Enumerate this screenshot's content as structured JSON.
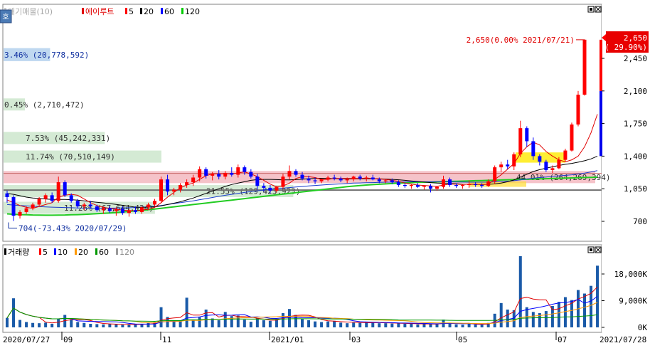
{
  "chart_data": [
    {
      "type": "candlestick",
      "title": "",
      "legend": [
        {
          "label": "대기매물(10)",
          "color": "#c8c8c8"
        },
        {
          "label": "에이루트",
          "color": "#e00000"
        },
        {
          "label": "5",
          "color": "#ff0000"
        },
        {
          "label": "20",
          "color": "#000000"
        },
        {
          "label": "60",
          "color": "#0000ff"
        },
        {
          "label": "120",
          "color": "#00cc00"
        }
      ],
      "y_ticks": [
        "2,450",
        "2,100",
        "1,750",
        "1,400",
        "1,050",
        "700"
      ],
      "y_tick_values": [
        2450,
        2100,
        1750,
        1400,
        1050,
        700
      ],
      "ylim": [
        520,
        2800
      ],
      "x_ticks": [
        "2020/07/27",
        "09",
        "11",
        "2021/01",
        "03",
        "05",
        "07",
        "2021/07/28"
      ],
      "price_label": {
        "value": "2,650",
        "change": "( 29.90%)"
      },
      "high_annotation": "2,650(0.00% 2021/07/21)",
      "low_annotation": "704(-73.43% 2020/07/29)",
      "volume_profile": [
        {
          "text": "3.46% (20,778,592)",
          "price_low": 2420,
          "price_high": 2560,
          "pct": 3.46
        },
        {
          "text": "0.45% (2,710,472)",
          "price_low": 1890,
          "price_high": 2020,
          "pct": 0.45
        },
        {
          "text": "7.53% (45,242,331)",
          "price_low": 1530,
          "price_high": 1660,
          "pct": 7.53
        },
        {
          "text": "11.74% (70,510,149)",
          "price_low": 1330,
          "price_high": 1460,
          "pct": 11.74
        },
        {
          "text": "21.55% (129,423,923)",
          "price_low": 960,
          "price_high": 1090,
          "pct": 21.55
        },
        {
          "text": "11.26% (67,644,434)",
          "price_low": 780,
          "price_high": 910,
          "pct": 11.26
        },
        {
          "text": "44.01% (264,269,394)",
          "price_low": 1110,
          "price_high": 1240,
          "pct": 44.01
        }
      ],
      "ohlc": [
        [
          1000,
          1030,
          900,
          960
        ],
        [
          960,
          980,
          704,
          760
        ],
        [
          760,
          820,
          730,
          800
        ],
        [
          800,
          860,
          780,
          840
        ],
        [
          840,
          900,
          820,
          880
        ],
        [
          880,
          960,
          860,
          940
        ],
        [
          940,
          1000,
          900,
          980
        ],
        [
          980,
          1010,
          900,
          920
        ],
        [
          920,
          1180,
          900,
          1120
        ],
        [
          1120,
          1140,
          960,
          980
        ],
        [
          980,
          1000,
          900,
          920
        ],
        [
          920,
          940,
          840,
          860
        ],
        [
          860,
          900,
          820,
          880
        ],
        [
          880,
          920,
          840,
          860
        ],
        [
          860,
          880,
          800,
          820
        ],
        [
          820,
          860,
          780,
          840
        ],
        [
          840,
          870,
          790,
          810
        ],
        [
          810,
          850,
          760,
          830
        ],
        [
          830,
          860,
          770,
          790
        ],
        [
          790,
          830,
          750,
          820
        ],
        [
          820,
          860,
          780,
          800
        ],
        [
          800,
          860,
          780,
          850
        ],
        [
          850,
          900,
          820,
          880
        ],
        [
          880,
          940,
          860,
          920
        ],
        [
          920,
          1180,
          900,
          1150
        ],
        [
          1150,
          1200,
          980,
          1020
        ],
        [
          1020,
          1060,
          980,
          1040
        ],
        [
          1040,
          1110,
          1010,
          1090
        ],
        [
          1090,
          1150,
          1060,
          1120
        ],
        [
          1120,
          1200,
          1080,
          1170
        ],
        [
          1170,
          1290,
          1130,
          1260
        ],
        [
          1260,
          1280,
          1160,
          1190
        ],
        [
          1190,
          1230,
          1140,
          1210
        ],
        [
          1210,
          1250,
          1150,
          1180
        ],
        [
          1180,
          1240,
          1150,
          1220
        ],
        [
          1220,
          1280,
          1180,
          1200
        ],
        [
          1200,
          1310,
          1170,
          1280
        ],
        [
          1280,
          1300,
          1200,
          1230
        ],
        [
          1230,
          1260,
          1160,
          1180
        ],
        [
          1180,
          1210,
          1040,
          1080
        ],
        [
          1080,
          1110,
          1020,
          1060
        ],
        [
          1060,
          1090,
          1000,
          1030
        ],
        [
          1030,
          1080,
          1010,
          1070
        ],
        [
          1070,
          1210,
          1050,
          1180
        ],
        [
          1180,
          1300,
          1150,
          1240
        ],
        [
          1240,
          1260,
          1180,
          1200
        ],
        [
          1200,
          1230,
          1140,
          1160
        ],
        [
          1160,
          1190,
          1110,
          1140
        ],
        [
          1140,
          1170,
          1100,
          1130
        ],
        [
          1130,
          1160,
          1110,
          1150
        ],
        [
          1150,
          1190,
          1130,
          1170
        ],
        [
          1170,
          1200,
          1140,
          1160
        ],
        [
          1160,
          1180,
          1120,
          1140
        ],
        [
          1140,
          1170,
          1110,
          1150
        ],
        [
          1150,
          1190,
          1130,
          1180
        ],
        [
          1180,
          1200,
          1140,
          1160
        ],
        [
          1160,
          1190,
          1130,
          1170
        ],
        [
          1170,
          1200,
          1140,
          1150
        ],
        [
          1150,
          1170,
          1110,
          1130
        ],
        [
          1130,
          1150,
          1110,
          1140
        ],
        [
          1140,
          1160,
          1100,
          1120
        ],
        [
          1120,
          1140,
          1070,
          1090
        ],
        [
          1090,
          1110,
          1060,
          1080
        ],
        [
          1080,
          1100,
          1050,
          1090
        ],
        [
          1090,
          1110,
          1060,
          1070
        ],
        [
          1070,
          1090,
          1040,
          1080
        ],
        [
          1080,
          1100,
          1010,
          1050
        ],
        [
          1050,
          1080,
          1030,
          1070
        ],
        [
          1070,
          1190,
          1050,
          1150
        ],
        [
          1150,
          1170,
          1070,
          1090
        ],
        [
          1090,
          1110,
          1060,
          1080
        ],
        [
          1080,
          1100,
          1050,
          1090
        ],
        [
          1090,
          1140,
          1060,
          1100
        ],
        [
          1100,
          1120,
          1070,
          1090
        ],
        [
          1090,
          1110,
          1060,
          1080
        ],
        [
          1080,
          1150,
          1070,
          1130
        ],
        [
          1130,
          1300,
          1100,
          1280
        ],
        [
          1280,
          1340,
          1230,
          1310
        ],
        [
          1310,
          1360,
          1260,
          1290
        ],
        [
          1290,
          1440,
          1250,
          1420
        ],
        [
          1420,
          1780,
          1390,
          1700
        ],
        [
          1700,
          1720,
          1500,
          1560
        ],
        [
          1560,
          1600,
          1360,
          1400
        ],
        [
          1400,
          1420,
          1300,
          1340
        ],
        [
          1340,
          1360,
          1230,
          1250
        ],
        [
          1250,
          1300,
          1220,
          1270
        ],
        [
          1270,
          1390,
          1260,
          1360
        ],
        [
          1360,
          1480,
          1340,
          1460
        ],
        [
          1460,
          1760,
          1450,
          1740
        ],
        [
          1740,
          2100,
          1720,
          2060
        ],
        [
          2060,
          2650,
          2050,
          2650
        ]
      ],
      "ma5": [
        930,
        900,
        870,
        850,
        840,
        860,
        880,
        900,
        960,
        980,
        990,
        980,
        940,
        900,
        870,
        850,
        840,
        830,
        820,
        815,
        815,
        820,
        830,
        850,
        900,
        960,
        1010,
        1060,
        1090,
        1110,
        1150,
        1190,
        1210,
        1210,
        1210,
        1210,
        1220,
        1230,
        1210,
        1180,
        1140,
        1100,
        1070,
        1080,
        1110,
        1160,
        1180,
        1180,
        1170,
        1150,
        1150,
        1160,
        1160,
        1160,
        1160,
        1160,
        1165,
        1160,
        1155,
        1150,
        1140,
        1130,
        1110,
        1100,
        1090,
        1085,
        1080,
        1075,
        1090,
        1100,
        1100,
        1095,
        1100,
        1100,
        1095,
        1100,
        1150,
        1200,
        1260,
        1320,
        1430,
        1500,
        1550,
        1520,
        1450,
        1400,
        1360,
        1340,
        1360,
        1400,
        1500,
        1650,
        1850
      ],
      "ma20": [
        1000,
        990,
        975,
        960,
        950,
        945,
        940,
        935,
        935,
        935,
        932,
        928,
        920,
        912,
        905,
        898,
        890,
        882,
        872,
        862,
        852,
        850,
        852,
        856,
        865,
        880,
        895,
        910,
        930,
        950,
        975,
        1000,
        1025,
        1050,
        1075,
        1095,
        1110,
        1125,
        1140,
        1148,
        1150,
        1150,
        1148,
        1145,
        1145,
        1148,
        1152,
        1158,
        1160,
        1162,
        1160,
        1158,
        1156,
        1155,
        1156,
        1157,
        1158,
        1158,
        1156,
        1154,
        1150,
        1146,
        1140,
        1134,
        1128,
        1122,
        1116,
        1110,
        1108,
        1106,
        1104,
        1100,
        1098,
        1097,
        1096,
        1097,
        1102,
        1110,
        1125,
        1145,
        1175,
        1205,
        1235,
        1255,
        1270,
        1285,
        1300,
        1312,
        1322,
        1335,
        1350,
        1370,
        1400
      ],
      "ma60": [
        880,
        875,
        870,
        866,
        862,
        858,
        855,
        852,
        850,
        848,
        846,
        844,
        842,
        840,
        840,
        840,
        841,
        842,
        844,
        846,
        848,
        852,
        856,
        862,
        870,
        880,
        890,
        900,
        910,
        920,
        932,
        944,
        956,
        968,
        980,
        990,
        1000,
        1010,
        1020,
        1028,
        1036,
        1044,
        1050,
        1056,
        1062,
        1068,
        1074,
        1080,
        1085,
        1090,
        1094,
        1098,
        1102,
        1106,
        1110,
        1112,
        1114,
        1116,
        1118,
        1120,
        1121,
        1122,
        1123,
        1124,
        1124,
        1124,
        1124,
        1124,
        1124,
        1123,
        1122,
        1121,
        1120,
        1120,
        1120,
        1121,
        1123,
        1126,
        1130,
        1136,
        1145,
        1155,
        1163,
        1170,
        1176,
        1182,
        1188,
        1194,
        1200,
        1208,
        1218,
        1230,
        1245
      ],
      "ma120": [
        780,
        776,
        772,
        770,
        768,
        767,
        766,
        766,
        767,
        768,
        770,
        772,
        775,
        778,
        782,
        786,
        790,
        795,
        800,
        806,
        812,
        818,
        825,
        832,
        840,
        848,
        856,
        864,
        872,
        880,
        888,
        896,
        904,
        912,
        920,
        928,
        936,
        944,
        952,
        960,
        968,
        976,
        984,
        992,
        1000,
        1008,
        1016,
        1024,
        1032,
        1040,
        1048,
        1056,
        1064,
        1072,
        1078,
        1084,
        1090,
        1094,
        1098,
        1102,
        1106,
        1110,
        1113,
        1116,
        1118,
        1120,
        1122,
        1124,
        1126,
        1128,
        1130,
        1132,
        1134,
        1136,
        1138,
        1140,
        1142,
        1144,
        1146,
        1148,
        1150,
        1152,
        1154,
        1156,
        1158,
        1160,
        1162,
        1164,
        1166,
        1168,
        1170,
        1172,
        1174
      ]
    },
    {
      "type": "bar",
      "title": "",
      "legend": [
        {
          "label": "거래량",
          "color": "#000000"
        },
        {
          "label": "5",
          "color": "#ff0000"
        },
        {
          "label": "10",
          "color": "#0000ff"
        },
        {
          "label": "20",
          "color": "#ff9900"
        },
        {
          "label": "60",
          "color": "#009900"
        },
        {
          "label": "120",
          "color": "#999999"
        }
      ],
      "y_ticks": [
        "18,000K",
        "9,000K",
        "0K"
      ],
      "y_tick_values": [
        18000,
        9000,
        0
      ],
      "ylim": [
        0,
        24000
      ],
      "values": [
        3200,
        9800,
        2500,
        1800,
        1500,
        1400,
        1600,
        1200,
        3000,
        4200,
        2800,
        1800,
        1500,
        1200,
        1100,
        1000,
        1100,
        1000,
        900,
        950,
        1000,
        1200,
        1500,
        1800,
        6800,
        3500,
        2400,
        2200,
        10000,
        2600,
        3400,
        6000,
        3000,
        2400,
        5200,
        3800,
        4000,
        2600,
        1900,
        3000,
        2400,
        2200,
        2600,
        4800,
        6200,
        4200,
        2800,
        2400,
        2000,
        1800,
        2000,
        2200,
        1600,
        1400,
        1600,
        1500,
        1800,
        1600,
        1400,
        1400,
        1300,
        1400,
        1200,
        1200,
        1000,
        1100,
        1100,
        1000,
        2600,
        1200,
        1000,
        900,
        1300,
        900,
        900,
        1500,
        4600,
        8200,
        6000,
        5800,
        24000,
        6800,
        5200,
        4800,
        5500,
        7200,
        8600,
        10200,
        9200,
        12600,
        11400,
        14000,
        20800
      ]
    }
  ]
}
